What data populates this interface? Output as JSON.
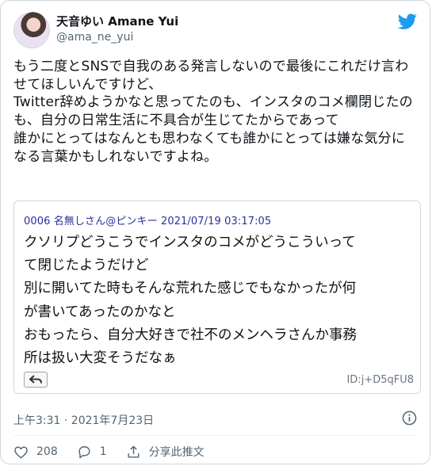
{
  "user": {
    "display_name": "天音ゆい Amane Yui",
    "handle": "@ama_ne_yui"
  },
  "tweet": {
    "text": "もう二度とSNSで自我のある発言しないので最後にこれだけ言わせてほしいんですけど、\nTwitter辞めようかなと思ってたのも、インスタのコメ欄閉じたのも、自分の日常生活に不具合が生じてたからであって\n誰かにとってはなんとも思わなくても誰かにとっては嫌な気分になる言葉かもしれないですよね。",
    "timestamp": "上午3:31 · 2021年7月23日"
  },
  "quoted_post": {
    "meta": "0006 名無しさん@ピンキー 2021/07/19 03:17:05",
    "body": "クソリプどうこうでインスタのコメがどうこういって\nて閉じたようだけど\n別に開いてた時もそんな荒れた感じでもなかったが何\nが書いてあったのかなと\nおもったら、自分大好きで社不のメンヘラさんか事務\n所は扱い大変そうだなぁ",
    "id": "ID:j+D5qFU8"
  },
  "actions": {
    "like_count": "208",
    "reply_count": "1",
    "share_label": "分享此推文"
  },
  "colors": {
    "twitter_blue": "#1d9bf0",
    "quote_meta": "#2b2f9e",
    "muted": "#536471"
  },
  "icons": [
    "twitter-bird-icon",
    "reply-arrow-icon",
    "info-icon",
    "heart-icon",
    "comment-icon",
    "share-icon"
  ]
}
